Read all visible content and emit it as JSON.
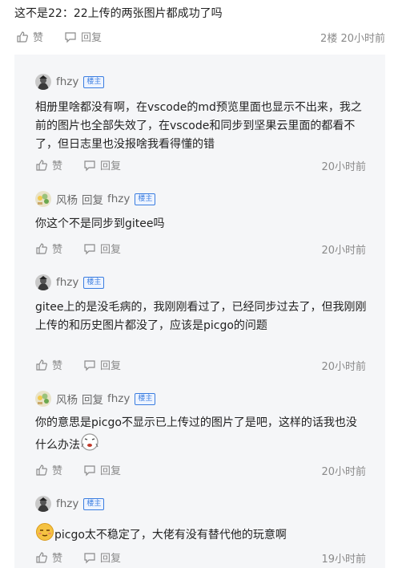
{
  "top": {
    "text": "这不是22：22上传的两张图片都成功了吗",
    "like_label": "赞",
    "reply_label": "回复",
    "meta": "2楼 20小时前"
  },
  "badge_label": "楼主",
  "replies": [
    {
      "author": "fhzy",
      "text": "相册里啥都没有啊，在vscode的md预览里面也显示不出来，我之前的图片也全部失效了，在vscode和同步到坚果云里面的都看不了，但日志里也没报啥我看得懂的错",
      "like_label": "赞",
      "reply_label": "回复",
      "time": "20小时前"
    },
    {
      "author": "风杨",
      "reply_word": "回复",
      "target": "fhzy",
      "text": "你这个不是同步到gitee吗",
      "like_label": "赞",
      "reply_label": "回复",
      "time": "20小时前"
    },
    {
      "author": "fhzy",
      "text": "gitee上的是没毛病的，我刚刚看过了，已经同步过去了，但我刚刚上传的和历史图片都没了，应该是picgo的问题",
      "like_label": "赞",
      "reply_label": "回复",
      "time": "20小时前"
    },
    {
      "author": "风杨",
      "reply_word": "回复",
      "target": "fhzy",
      "text": "你的意思是picgo不显示已上传过的图片了是吧，这样的话我也没什么办法",
      "like_label": "赞",
      "reply_label": "回复",
      "time": "20小时前"
    },
    {
      "author": "fhzy",
      "text": "picgo太不稳定了，大佬有没有替代他的玩意啊",
      "like_label": "赞",
      "reply_label": "回复",
      "time": "19小时前"
    }
  ]
}
